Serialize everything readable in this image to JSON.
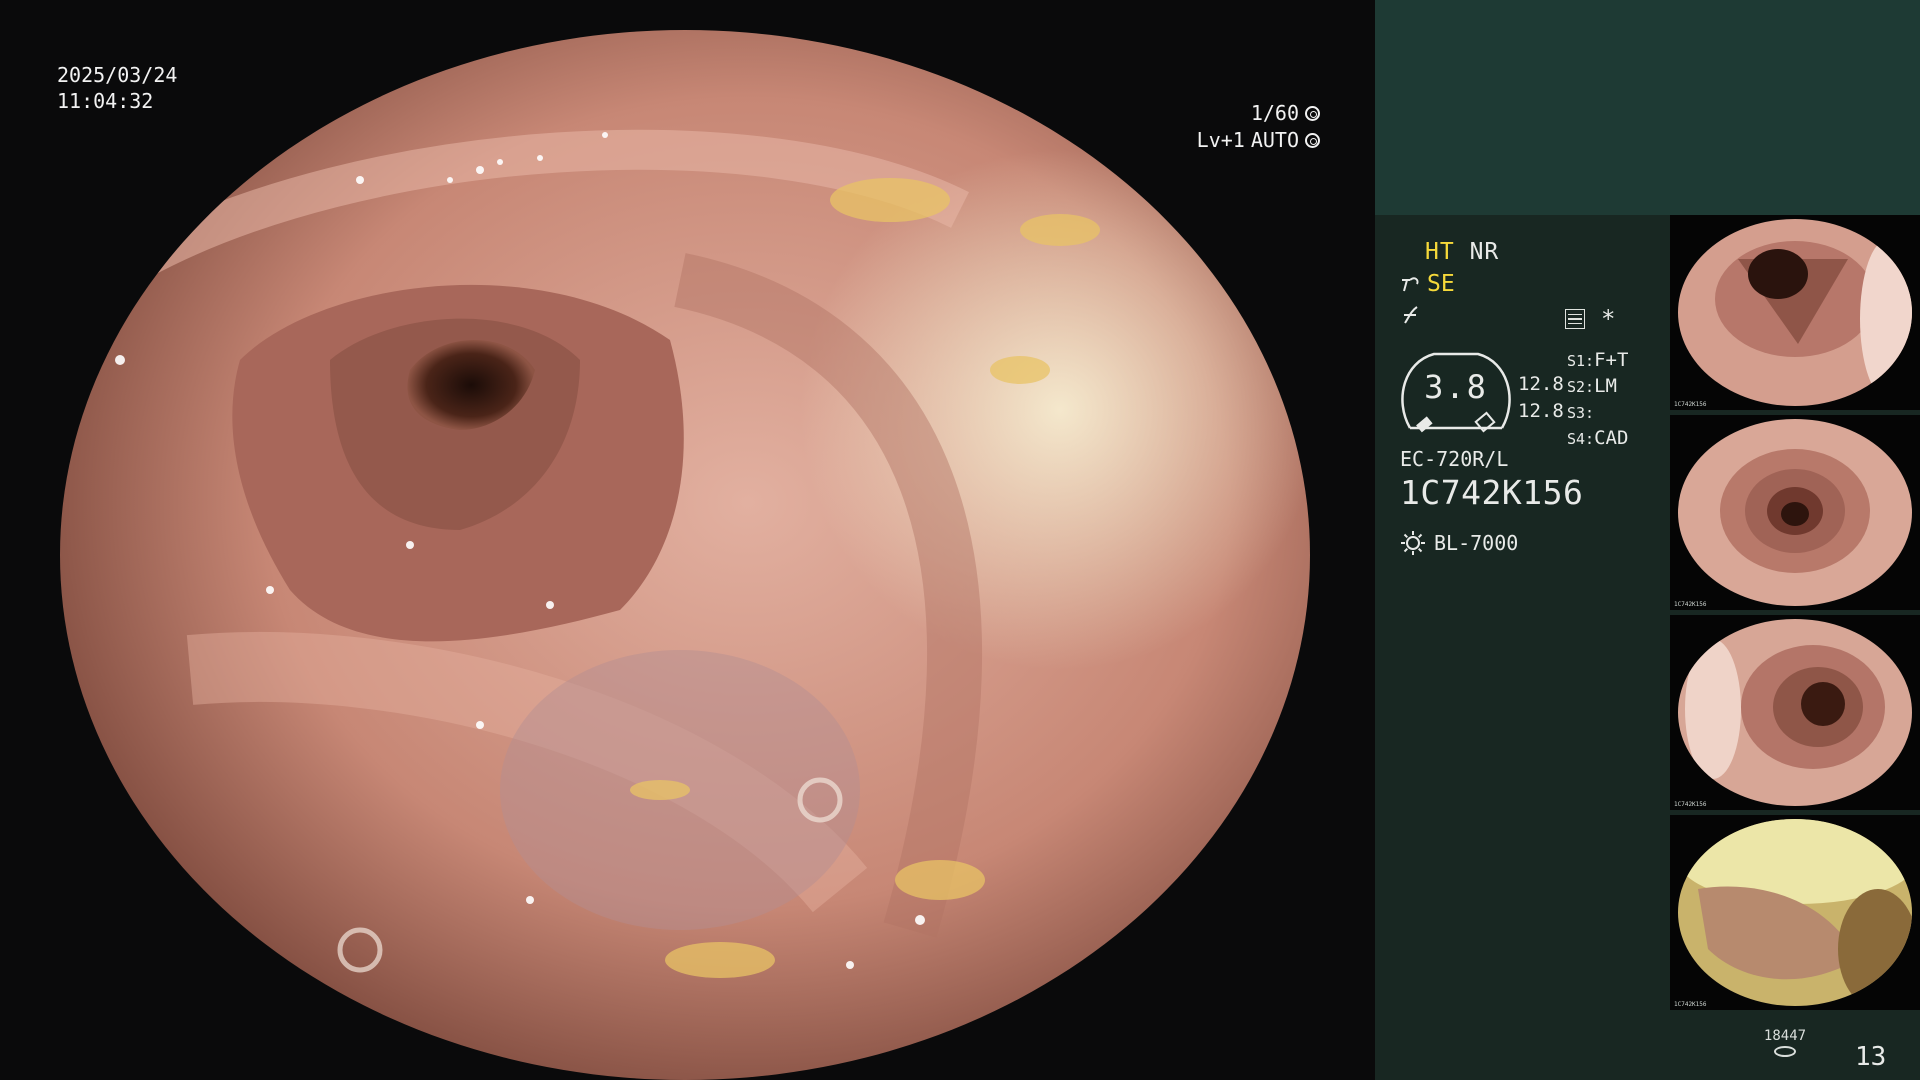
{
  "viewer": {
    "date": "2025/03/24",
    "time": "11:04:32",
    "shutter": "1/60",
    "level": "Lv+1",
    "exposure_mode": "AUTO"
  },
  "panel": {
    "mode_primary": "HT",
    "mode_secondary": "NR",
    "enhance": "SE",
    "gauge_value": "3.8",
    "gauge_line1": "12.8",
    "gauge_line2": "12.8",
    "settings": [
      {
        "key": "S1:",
        "value": "F+T"
      },
      {
        "key": "S2:",
        "value": "LM"
      },
      {
        "key": "S3:",
        "value": ""
      },
      {
        "key": "S4:",
        "value": "CAD"
      }
    ],
    "scope_model": "EC-720R/L",
    "scope_serial": "1C742K156",
    "light_source": "BL-7000",
    "capture_count": "18447",
    "page_number": "13"
  },
  "thumbnails": [
    {
      "meta": "1C742K156"
    },
    {
      "meta": "1C742K156"
    },
    {
      "meta": "1C742K156"
    },
    {
      "meta": "1C742K156"
    }
  ],
  "colors": {
    "panel_bg": "#182722",
    "panel_top": "#1e3a34",
    "highlight": "#f6d93a",
    "tissue": "#c98878"
  }
}
